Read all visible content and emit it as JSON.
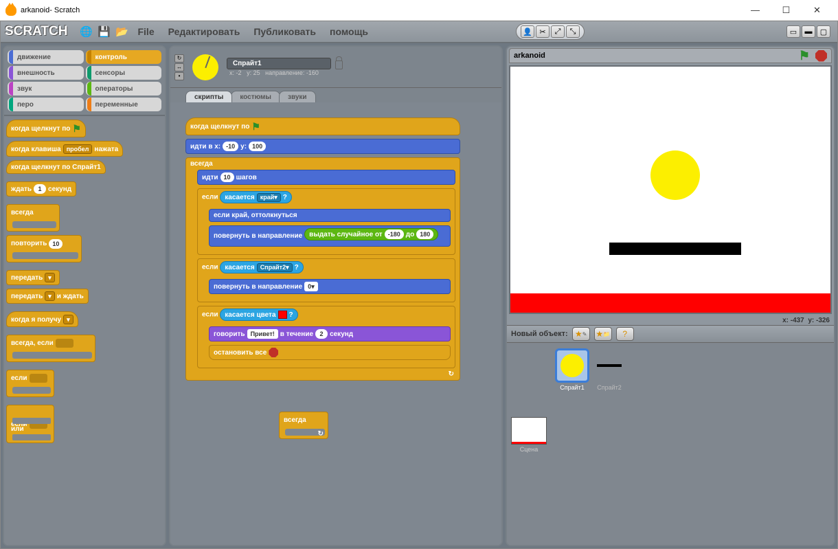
{
  "window": {
    "title": "arkanoid- Scratch"
  },
  "menu": {
    "file": "File",
    "edit": "Редактировать",
    "publish": "Публиковать",
    "help": "помощь"
  },
  "categories": {
    "motion": "движение",
    "control": "контроль",
    "looks": "внешность",
    "sensing": "сенсоры",
    "sound": "звук",
    "operators": "операторы",
    "pen": "перо",
    "variables": "переменные"
  },
  "palette": {
    "when_flag": "когда щелкнут по",
    "when_key": "когда клавиша",
    "key": "пробел",
    "pressed": "нажата",
    "when_sprite": "когда щелкнут по  Спрайт1",
    "wait": "ждать",
    "wait_n": "1",
    "seconds": "секунд",
    "forever": "всегда",
    "repeat": "повторить",
    "repeat_n": "10",
    "broadcast": "передать",
    "broadcast_wait_tail": "и ждать",
    "when_receive": "когда я получу",
    "forever_if": "всегда, если",
    "if": "если",
    "else": "или"
  },
  "sprite": {
    "name": "Спрайт1",
    "x_label": "x:",
    "x": "-2",
    "y_label": "y:",
    "y": "25",
    "dir_label": "направление:",
    "dir": "-160"
  },
  "tabs": {
    "scripts": "скрипты",
    "costumes": "костюмы",
    "sounds": "звуки"
  },
  "script": {
    "when_flag": "когда щелкнут по",
    "goto": "идти в x:",
    "gx": "-10",
    "gy_label": "y:",
    "gy": "100",
    "forever": "всегда",
    "move": "идти",
    "steps": "10",
    "steps_tail": "шагов",
    "if": "если",
    "touching": "касается",
    "edge": "край",
    "q": "?",
    "if_edge_bounce": "если край, оттолкнуться",
    "point_dir": "повернуть в направление",
    "random": "выдать случайное от",
    "r1": "-180",
    "to": "до",
    "r2": "180",
    "sprite2": "Спрайт2",
    "zero": "0",
    "touch_color": "касается цвета",
    "say": "говорить",
    "hello": "Привет!",
    "for": "в течение",
    "say_n": "2",
    "say_sec": "секунд",
    "stop_all": "остановить все",
    "loose_forever": "всегда"
  },
  "stage": {
    "title": "arkanoid",
    "coord_x": "x: -437",
    "coord_y": "y: -326",
    "new_object": "Новый объект:",
    "sp1": "Спрайт1",
    "sp2": "Спрайт2",
    "scene": "Сцена"
  }
}
